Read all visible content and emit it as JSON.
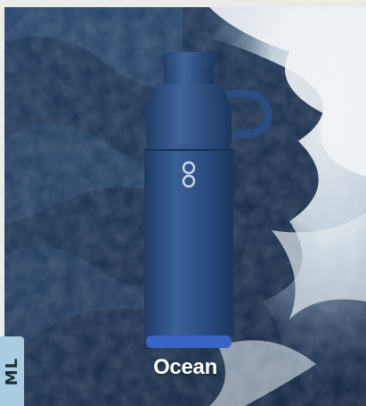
{
  "product": {
    "name": "Ocean"
  },
  "side_badge": {
    "text": "ML"
  },
  "icons": {
    "bottle_logo": "infinity-loop-logo-icon"
  },
  "colors": {
    "sea_dark": "#1a2d47",
    "sea_mid": "#2b4a6e",
    "foam": "#eef3f6",
    "bottle_body": "#2c4f84",
    "bottle_base": "#3a63c8",
    "badge_bg": "#a8cde0"
  }
}
